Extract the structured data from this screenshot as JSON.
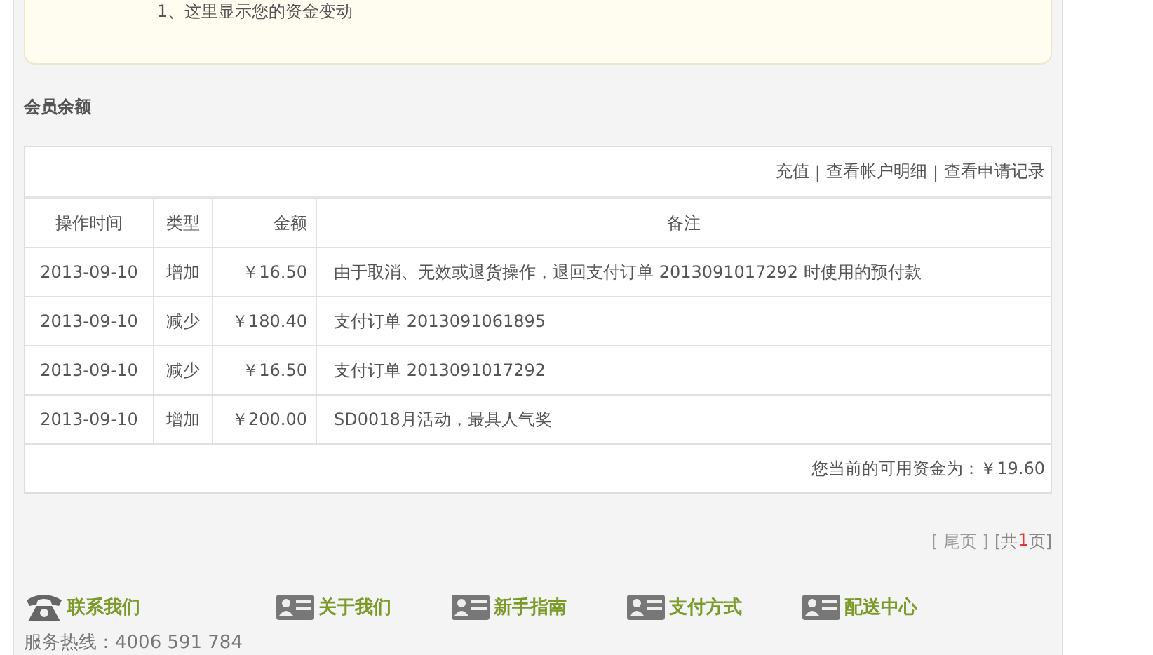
{
  "notice": {
    "text": "1、这里显示您的资金变动"
  },
  "balance": {
    "title": "会员余额",
    "links": [
      {
        "label": "充值"
      },
      {
        "label": "查看帐户明细"
      },
      {
        "label": "查看申请记录"
      }
    ],
    "separator": "|",
    "columns": [
      "操作时间",
      "类型",
      "金额",
      "备注"
    ],
    "rows": [
      {
        "date": "2013-09-10",
        "type": "增加",
        "amount": "￥16.50",
        "note": "由于取消、无效或退货操作，退回支付订单 2013091017292 时使用的预付款"
      },
      {
        "date": "2013-09-10",
        "type": "减少",
        "amount": "￥180.40",
        "note": "支付订单 2013091061895"
      },
      {
        "date": "2013-09-10",
        "type": "减少",
        "amount": "￥16.50",
        "note": "支付订单 2013091017292"
      },
      {
        "date": "2013-09-10",
        "type": "增加",
        "amount": "￥200.00",
        "note": "SD0018月活动，最具人气奖"
      }
    ],
    "total": "您当前的可用资金为：￥19.60"
  },
  "pagination": {
    "last_link": "[ 尾页 ]",
    "total_prefix": "[共",
    "page_count": "1",
    "total_suffix": "页]"
  },
  "footer": {
    "links": [
      {
        "kind": "phone",
        "label": "联系我们"
      },
      {
        "kind": "card",
        "label": "关于我们"
      },
      {
        "kind": "card",
        "label": "新手指南"
      },
      {
        "kind": "card",
        "label": "支付方式"
      },
      {
        "kind": "card",
        "label": "配送中心"
      }
    ],
    "hotline": "服务热线：4006 591 784"
  }
}
